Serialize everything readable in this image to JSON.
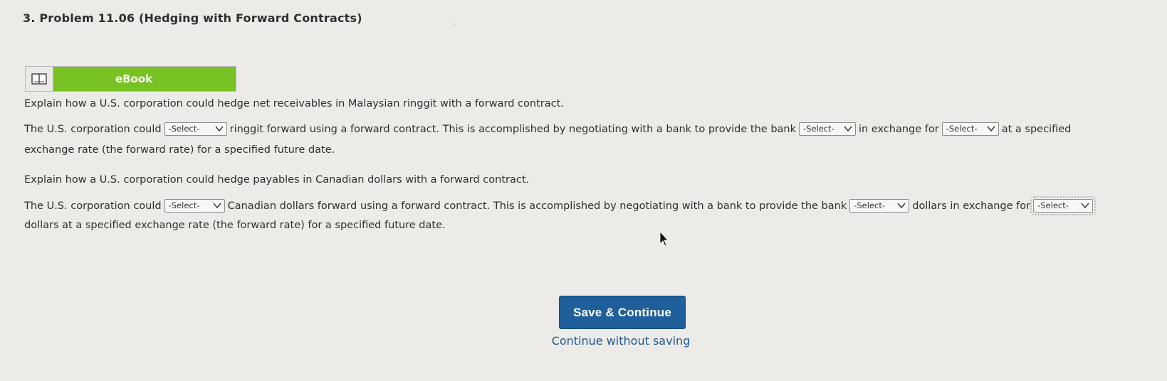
{
  "problem": {
    "title": "3.  Problem 11.06 (Hedging with Forward Contracts)"
  },
  "ebook": {
    "label": "eBook",
    "icon": "book-icon"
  },
  "question1": {
    "prompt": "Explain how a U.S. corporation could hedge net receivables in Malaysian ringgit with a forward contract.",
    "text_before_select1": "The U.S. corporation could",
    "select1": "-Select-",
    "text_after_select1": "ringgit forward using a forward contract. This is accomplished by negotiating with a bank to provide the bank",
    "select2": "-Select-",
    "text_after_select2": "in exchange for",
    "select3": "-Select-",
    "text_after_select3": "at a specified",
    "line2": "exchange rate (the forward rate) for a specified future date."
  },
  "question2": {
    "prompt": "Explain how a U.S. corporation could hedge payables in Canadian dollars with a forward contract.",
    "text_before_select1": "The U.S. corporation could",
    "select1": "-Select-",
    "text_after_select1": "Canadian dollars forward using a forward contract. This is accomplished by negotiating with a bank to provide the bank",
    "select2": "-Select-",
    "text_after_select2": "dollars in exchange for",
    "select3": "-Select-",
    "line2": "dollars at a specified exchange rate (the forward rate) for a specified future date."
  },
  "actions": {
    "save_label": "Save & Continue",
    "continue_label": "Continue without saving"
  },
  "colors": {
    "ebook_green": "#78c224",
    "save_button": "#1f5f9b",
    "link": "#205a93",
    "background": "#ecebe8"
  }
}
